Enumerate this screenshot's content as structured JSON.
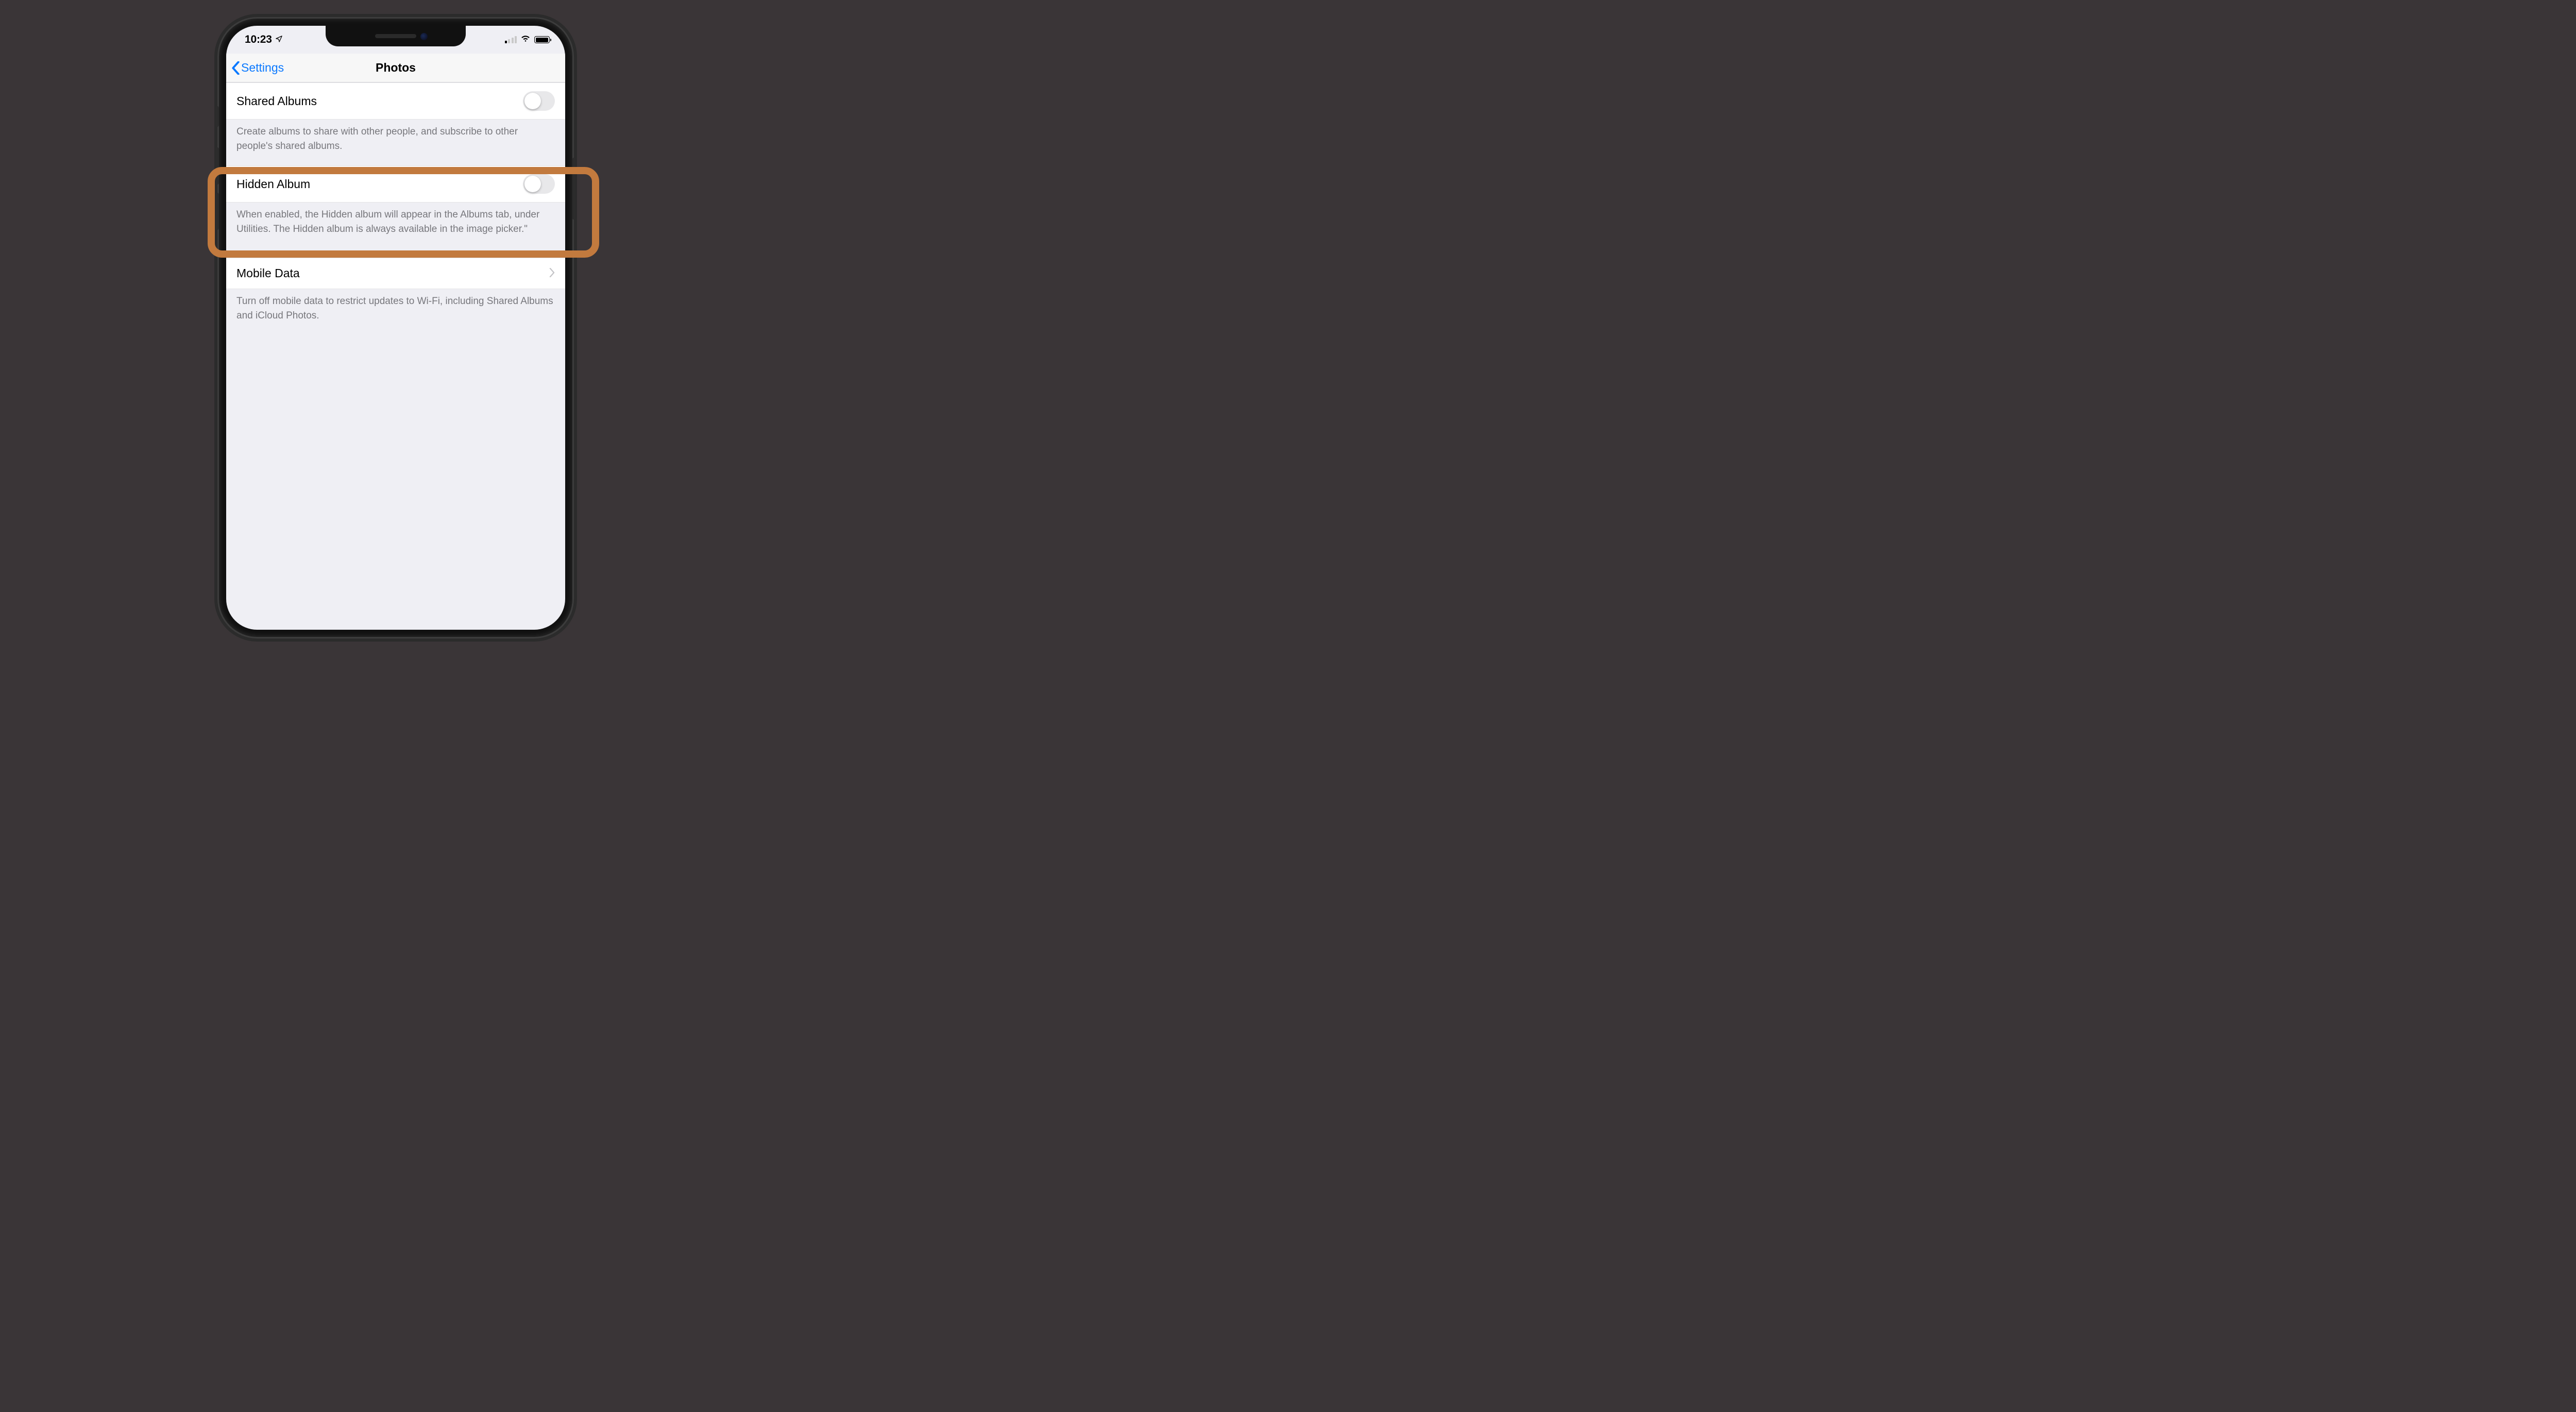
{
  "status": {
    "time": "10:23",
    "location_icon": "location-arrow",
    "signal_bars_active": 1,
    "wifi": true,
    "battery_pct": 95
  },
  "nav": {
    "back_label": "Settings",
    "title": "Photos"
  },
  "groups": {
    "shared_albums": {
      "label": "Shared Albums",
      "toggle_on": false,
      "footer": "Create albums to share with other people, and subscribe to other people's shared albums."
    },
    "hidden_album": {
      "label": "Hidden Album",
      "toggle_on": false,
      "footer": "When enabled, the Hidden album will appear in the Albums tab, under Utilities. The Hidden album is always available in the image picker.\""
    },
    "mobile_data": {
      "label": "Mobile Data",
      "footer": "Turn off mobile data to restrict updates to Wi-Fi, including Shared Albums and iCloud Photos."
    }
  },
  "highlight": {
    "target": "hidden-album-section"
  }
}
